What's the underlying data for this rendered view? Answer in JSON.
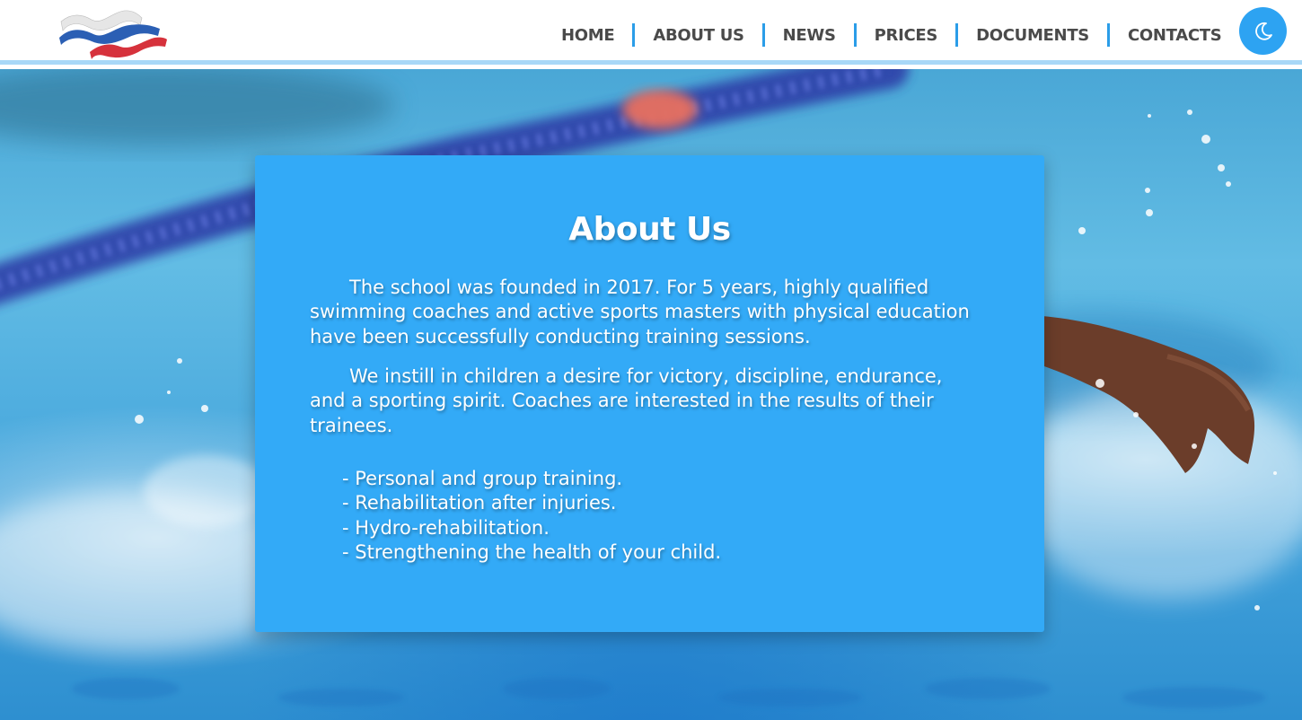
{
  "header": {
    "nav": [
      "HOME",
      "ABOUT US",
      "NEWS",
      "PRICES",
      "DOCUMENTS",
      "CONTACTS"
    ],
    "theme_toggle_icon": "moon-icon"
  },
  "about": {
    "title": "About Us",
    "paragraphs": [
      "The school was founded in 2017. For 5 years, highly qualified swimming coaches and active sports masters with physical education have been successfully conducting training sessions.",
      "We instill in children a desire for victory, discipline, endurance, and a sporting spirit. Coaches are interested in the results of their trainees."
    ],
    "services": [
      "- Personal and group training.",
      "- Rehabilitation after injuries.",
      "- Hydro-rehabilitation.",
      "- Strengthening the health of your child."
    ]
  },
  "colors": {
    "accent": "#2da3f2",
    "card": "#33aaf7",
    "nav_text": "#4a4a4a",
    "separator": "#2b9de8",
    "logo_white": "#e6e6e6",
    "logo_blue": "#2b5fb4",
    "logo_red": "#d6323c"
  }
}
